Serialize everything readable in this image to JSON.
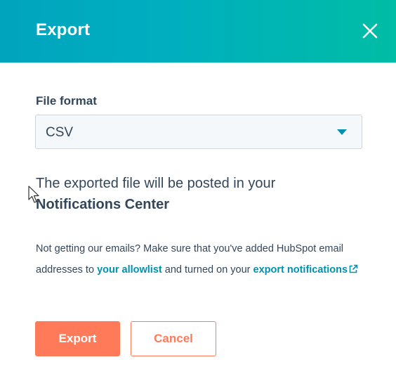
{
  "dialog": {
    "title": "Export",
    "close_icon": "close-icon",
    "header_gradient": [
      "#00a4bd",
      "#00bda5"
    ]
  },
  "form": {
    "file_format_label": "File format",
    "file_format_value": "CSV"
  },
  "description": {
    "text": "The exported file will be posted in your",
    "bold": "Notifications Center"
  },
  "note": {
    "text_1": "Not getting our emails? Make sure that you've added HubSpot email addresses to",
    "link_allowlist": "your allowlist",
    "text_2": "and turned on your",
    "link_notifications": "export notifications",
    "external_icon": "external-link-icon"
  },
  "buttons": {
    "export_label": "Export",
    "cancel_label": "Cancel"
  },
  "colors": {
    "primary": "#ff7a59",
    "link": "#0091ae",
    "text": "#33475b"
  }
}
